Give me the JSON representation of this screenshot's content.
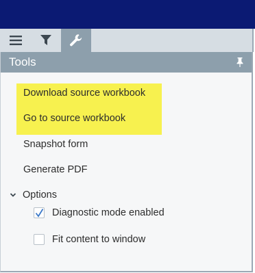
{
  "tabs": {
    "menu": {
      "icon": "hamburger-menu-icon"
    },
    "filter": {
      "icon": "filter-icon"
    },
    "tools": {
      "icon": "wrench-icon",
      "active": true
    }
  },
  "panel": {
    "title": "Tools",
    "pin_icon": "pin-icon"
  },
  "menu_items": [
    {
      "label": "Download source workbook",
      "highlighted": true
    },
    {
      "label": "Go to source workbook",
      "highlighted": true
    },
    {
      "label": "Snapshot form",
      "highlighted": false
    },
    {
      "label": "Generate PDF",
      "highlighted": false
    }
  ],
  "options": {
    "label": "Options",
    "expanded": true,
    "checkboxes": [
      {
        "label": "Diagnostic mode enabled",
        "checked": true
      },
      {
        "label": "Fit content to window",
        "checked": false
      }
    ]
  },
  "colors": {
    "top_bar": "#0b1a73",
    "tab_strip": "#d6dde3",
    "active_tab": "#8d9fac",
    "highlight": "#f7f14f",
    "check_mark": "#3a78c8"
  }
}
